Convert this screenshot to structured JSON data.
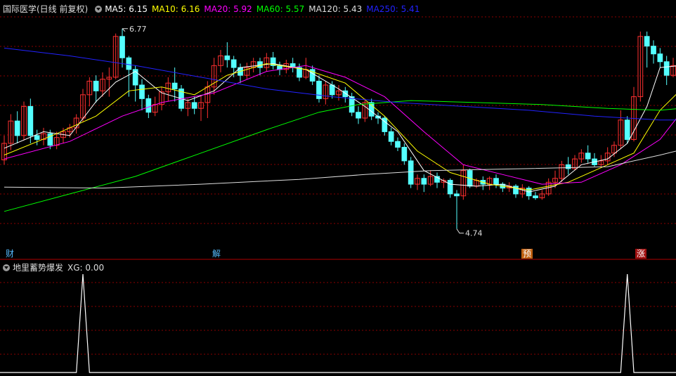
{
  "header": {
    "title": "国际医学(日线 前复权)",
    "ma": [
      {
        "label": "MA5: 6.15",
        "color": "#ffffff"
      },
      {
        "label": "MA10: 6.16",
        "color": "#ffff00"
      },
      {
        "label": "MA20: 5.92",
        "color": "#ff00ff"
      },
      {
        "label": "MA60: 5.57",
        "color": "#00ff00"
      },
      {
        "label": "MA120: 5.43",
        "color": "#dddddd"
      },
      {
        "label": "MA250: 5.41",
        "color": "#2222ff"
      }
    ]
  },
  "indicator_header": {
    "name": "地里蓄势爆发",
    "value": "XG: 0.00"
  },
  "tags": [
    {
      "text": "财",
      "color": "#55bbff",
      "bg": "transparent"
    },
    {
      "text": "解",
      "color": "#55bbff",
      "bg": "transparent"
    },
    {
      "text": "预",
      "color": "#ffffff",
      "bg": "#c06010"
    },
    {
      "text": "涨",
      "color": "#ffffff",
      "bg": "#a01010"
    }
  ],
  "annotations": {
    "high": "6.77",
    "low": "4.74"
  },
  "colors": {
    "up": "#ff3030",
    "down": "#54ffff",
    "grid": "#8b0000"
  },
  "chart_data": {
    "type": "candlestick",
    "y_range": [
      4.55,
      6.95
    ],
    "candles": [
      [
        5.45,
        5.62,
        5.7,
        5.4
      ],
      [
        5.62,
        5.85,
        5.92,
        5.55
      ],
      [
        5.85,
        5.7,
        5.95,
        5.62
      ],
      [
        5.7,
        6.0,
        6.05,
        5.65
      ],
      [
        6.0,
        5.7,
        6.08,
        5.62
      ],
      [
        5.7,
        5.66,
        5.76,
        5.6
      ],
      [
        5.66,
        5.72,
        5.78,
        5.6
      ],
      [
        5.72,
        5.6,
        5.76,
        5.56
      ],
      [
        5.6,
        5.68,
        5.74,
        5.56
      ],
      [
        5.68,
        5.74,
        5.78,
        5.62
      ],
      [
        5.74,
        5.78,
        5.82,
        5.68
      ],
      [
        5.78,
        5.88,
        5.92,
        5.72
      ],
      [
        5.88,
        6.12,
        6.18,
        5.84
      ],
      [
        6.12,
        6.26,
        6.3,
        6.0
      ],
      [
        6.26,
        6.16,
        6.32,
        6.04
      ],
      [
        6.16,
        6.28,
        6.35,
        6.1
      ],
      [
        6.28,
        6.3,
        6.4,
        6.1
      ],
      [
        6.3,
        6.72,
        6.75,
        6.28
      ],
      [
        6.72,
        6.5,
        6.8,
        6.4
      ],
      [
        6.5,
        6.38,
        6.52,
        6.1
      ],
      [
        6.38,
        6.22,
        6.42,
        6.05
      ],
      [
        6.22,
        6.08,
        6.28,
        5.96
      ],
      [
        6.08,
        5.94,
        6.12,
        5.88
      ],
      [
        5.94,
        6.02,
        6.1,
        5.9
      ],
      [
        6.02,
        6.15,
        6.2,
        5.96
      ],
      [
        6.15,
        6.24,
        6.3,
        6.05
      ],
      [
        6.24,
        6.18,
        6.4,
        6.05
      ],
      [
        6.18,
        5.98,
        6.22,
        5.95
      ],
      [
        5.98,
        6.04,
        6.08,
        5.9
      ],
      [
        6.04,
        5.98,
        6.1,
        5.92
      ],
      [
        5.98,
        6.04,
        6.12,
        5.85
      ],
      [
        6.04,
        6.2,
        6.26,
        5.88
      ],
      [
        6.2,
        6.42,
        6.5,
        6.12
      ],
      [
        6.42,
        6.52,
        6.58,
        6.35
      ],
      [
        6.52,
        6.48,
        6.66,
        6.4
      ],
      [
        6.48,
        6.4,
        6.52,
        6.3
      ],
      [
        6.4,
        6.32,
        6.44,
        6.24
      ],
      [
        6.32,
        6.4,
        6.45,
        6.28
      ],
      [
        6.4,
        6.46,
        6.5,
        6.35
      ],
      [
        6.46,
        6.4,
        6.5,
        6.32
      ],
      [
        6.4,
        6.5,
        6.55,
        6.36
      ],
      [
        6.5,
        6.42,
        6.56,
        6.38
      ],
      [
        6.42,
        6.38,
        6.46,
        6.32
      ],
      [
        6.38,
        6.44,
        6.48,
        6.34
      ],
      [
        6.44,
        6.4,
        6.5,
        6.35
      ],
      [
        6.4,
        6.3,
        6.44,
        6.26
      ],
      [
        6.3,
        6.38,
        6.5,
        6.28
      ],
      [
        6.38,
        6.26,
        6.42,
        6.22
      ],
      [
        6.26,
        6.08,
        6.32,
        6.04
      ],
      [
        6.08,
        6.22,
        6.26,
        6.02
      ],
      [
        6.22,
        6.12,
        6.26,
        6.08
      ],
      [
        6.12,
        6.16,
        6.22,
        6.06
      ],
      [
        6.16,
        6.1,
        6.2,
        6.04
      ],
      [
        6.1,
        5.94,
        6.14,
        5.9
      ],
      [
        5.94,
        5.88,
        6.0,
        5.82
      ],
      [
        5.88,
        6.04,
        6.08,
        5.84
      ],
      [
        6.04,
        5.9,
        6.08,
        5.86
      ],
      [
        5.9,
        5.88,
        5.94,
        5.82
      ],
      [
        5.88,
        5.74,
        5.9,
        5.7
      ],
      [
        5.74,
        5.64,
        5.78,
        5.6
      ],
      [
        5.64,
        5.58,
        5.68,
        5.54
      ],
      [
        5.58,
        5.44,
        5.62,
        5.4
      ],
      [
        5.44,
        5.2,
        5.48,
        5.16
      ],
      [
        5.2,
        5.26,
        5.3,
        5.14
      ],
      [
        5.26,
        5.2,
        5.3,
        5.12
      ],
      [
        5.2,
        5.28,
        5.34,
        5.18
      ],
      [
        5.28,
        5.22,
        5.32,
        5.16
      ],
      [
        5.22,
        5.24,
        5.26,
        5.16
      ],
      [
        5.24,
        5.1,
        5.26,
        5.06
      ],
      [
        5.1,
        5.08,
        5.14,
        4.74
      ],
      [
        5.08,
        5.34,
        5.4,
        5.04
      ],
      [
        5.34,
        5.18,
        5.36,
        5.16
      ],
      [
        5.18,
        5.24,
        5.26,
        5.16
      ],
      [
        5.24,
        5.2,
        5.28,
        5.14
      ],
      [
        5.2,
        5.26,
        5.28,
        5.14
      ],
      [
        5.26,
        5.2,
        5.3,
        5.16
      ],
      [
        5.2,
        5.16,
        5.22,
        5.12
      ],
      [
        5.16,
        5.18,
        5.22,
        5.12
      ],
      [
        5.18,
        5.1,
        5.2,
        5.06
      ],
      [
        5.1,
        5.16,
        5.2,
        5.06
      ],
      [
        5.16,
        5.08,
        5.18,
        5.04
      ],
      [
        5.08,
        5.06,
        5.12,
        5.04
      ],
      [
        5.06,
        5.1,
        5.14,
        5.04
      ],
      [
        5.1,
        5.22,
        5.26,
        5.08
      ],
      [
        5.22,
        5.26,
        5.34,
        5.16
      ],
      [
        5.26,
        5.4,
        5.44,
        5.22
      ],
      [
        5.4,
        5.36,
        5.48,
        5.3
      ],
      [
        5.36,
        5.46,
        5.5,
        5.34
      ],
      [
        5.46,
        5.52,
        5.56,
        5.42
      ],
      [
        5.52,
        5.46,
        5.6,
        5.42
      ],
      [
        5.46,
        5.4,
        5.52,
        5.38
      ],
      [
        5.4,
        5.44,
        5.5,
        5.38
      ],
      [
        5.44,
        5.52,
        5.58,
        5.4
      ],
      [
        5.52,
        5.6,
        5.64,
        5.48
      ],
      [
        5.6,
        5.86,
        5.96,
        5.56
      ],
      [
        5.86,
        5.66,
        5.9,
        5.62
      ],
      [
        5.66,
        6.1,
        6.2,
        5.64
      ],
      [
        6.1,
        6.72,
        6.77,
        6.05
      ],
      [
        6.72,
        6.62,
        6.77,
        6.4
      ],
      [
        6.62,
        6.54,
        6.68,
        6.44
      ],
      [
        6.54,
        6.46,
        6.6,
        6.4
      ],
      [
        6.46,
        6.32,
        6.52,
        6.22
      ],
      [
        6.32,
        6.42,
        6.5,
        6.3
      ]
    ],
    "moving_averages": [
      {
        "name": "MA5",
        "color": "#ffffff",
        "points": [
          [
            0,
            5.57
          ],
          [
            6,
            5.74
          ],
          [
            10,
            5.7
          ],
          [
            14,
            6.05
          ],
          [
            17,
            6.25
          ],
          [
            20,
            6.36
          ],
          [
            24,
            6.14
          ],
          [
            28,
            6.06
          ],
          [
            32,
            6.16
          ],
          [
            36,
            6.4
          ],
          [
            41,
            6.44
          ],
          [
            46,
            6.38
          ],
          [
            51,
            6.18
          ],
          [
            55,
            6.0
          ],
          [
            60,
            5.74
          ],
          [
            64,
            5.34
          ],
          [
            68,
            5.2
          ],
          [
            72,
            5.18
          ],
          [
            76,
            5.2
          ],
          [
            80,
            5.12
          ],
          [
            84,
            5.18
          ],
          [
            88,
            5.4
          ],
          [
            92,
            5.46
          ],
          [
            95,
            5.62
          ],
          [
            98,
            6.0
          ],
          [
            100,
            6.4
          ],
          [
            103,
            6.42
          ]
        ]
      },
      {
        "name": "MA10",
        "color": "#ffff00",
        "points": [
          [
            0,
            5.5
          ],
          [
            8,
            5.72
          ],
          [
            14,
            5.9
          ],
          [
            19,
            6.16
          ],
          [
            24,
            6.2
          ],
          [
            29,
            6.12
          ],
          [
            34,
            6.32
          ],
          [
            40,
            6.44
          ],
          [
            46,
            6.38
          ],
          [
            52,
            6.24
          ],
          [
            58,
            5.9
          ],
          [
            63,
            5.54
          ],
          [
            68,
            5.32
          ],
          [
            74,
            5.2
          ],
          [
            80,
            5.14
          ],
          [
            86,
            5.22
          ],
          [
            92,
            5.4
          ],
          [
            96,
            5.52
          ],
          [
            100,
            5.96
          ],
          [
            103,
            6.16
          ]
        ]
      },
      {
        "name": "MA20",
        "color": "#ff00ff",
        "points": [
          [
            0,
            5.46
          ],
          [
            10,
            5.64
          ],
          [
            18,
            5.9
          ],
          [
            24,
            6.04
          ],
          [
            32,
            6.14
          ],
          [
            40,
            6.36
          ],
          [
            46,
            6.42
          ],
          [
            52,
            6.3
          ],
          [
            58,
            6.1
          ],
          [
            64,
            5.74
          ],
          [
            70,
            5.4
          ],
          [
            76,
            5.3
          ],
          [
            82,
            5.2
          ],
          [
            88,
            5.22
          ],
          [
            94,
            5.4
          ],
          [
            100,
            5.66
          ],
          [
            103,
            5.92
          ]
        ]
      },
      {
        "name": "MA60",
        "color": "#00ff00",
        "points": [
          [
            0,
            4.92
          ],
          [
            10,
            5.1
          ],
          [
            20,
            5.28
          ],
          [
            30,
            5.52
          ],
          [
            40,
            5.76
          ],
          [
            48,
            5.94
          ],
          [
            54,
            6.02
          ],
          [
            62,
            6.06
          ],
          [
            72,
            6.04
          ],
          [
            82,
            6.02
          ],
          [
            92,
            5.98
          ],
          [
            100,
            5.96
          ],
          [
            103,
            5.98
          ]
        ]
      },
      {
        "name": "MA120",
        "color": "#dddddd",
        "points": [
          [
            0,
            5.17
          ],
          [
            15,
            5.16
          ],
          [
            30,
            5.2
          ],
          [
            45,
            5.25
          ],
          [
            55,
            5.3
          ],
          [
            65,
            5.34
          ],
          [
            80,
            5.36
          ],
          [
            92,
            5.38
          ],
          [
            100,
            5.5
          ],
          [
            103,
            5.55
          ]
        ]
      },
      {
        "name": "MA250",
        "color": "#2222ff",
        "points": [
          [
            0,
            6.6
          ],
          [
            10,
            6.52
          ],
          [
            20,
            6.42
          ],
          [
            30,
            6.3
          ],
          [
            40,
            6.18
          ],
          [
            50,
            6.1
          ],
          [
            60,
            6.04
          ],
          [
            70,
            6.0
          ],
          [
            80,
            5.96
          ],
          [
            90,
            5.9
          ],
          [
            100,
            5.86
          ],
          [
            103,
            5.86
          ]
        ]
      }
    ],
    "indicator": {
      "name": "XG",
      "values_at": [
        12,
        95
      ],
      "peak": 1,
      "base": 0
    }
  }
}
